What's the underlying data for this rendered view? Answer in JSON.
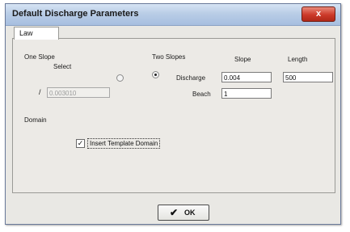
{
  "window": {
    "title": "Default Discharge Parameters",
    "close_label": "x"
  },
  "tabs": [
    {
      "label": "Law"
    }
  ],
  "one_slope": {
    "heading": "One Slope",
    "select_label": "Select",
    "slope_marker": "/",
    "value": "0.003010"
  },
  "two_slopes": {
    "heading": "Two Slopes",
    "col_slope": "Slope",
    "col_length": "Length",
    "discharge_label": "Discharge",
    "discharge_slope": "0.004",
    "discharge_length": "500",
    "beach_label": "Beach",
    "beach_slope": "1"
  },
  "domain": {
    "heading": "Domain",
    "insert_template_label": "Insert Template Domain",
    "insert_template_checked": true,
    "check_mark": "✓"
  },
  "buttons": {
    "ok_label": "OK",
    "ok_icon": "✔"
  },
  "colors": {
    "titlebar": "#b9cde6",
    "close_button": "#cc3a2a",
    "dialog_face": "#e9e8e4"
  }
}
